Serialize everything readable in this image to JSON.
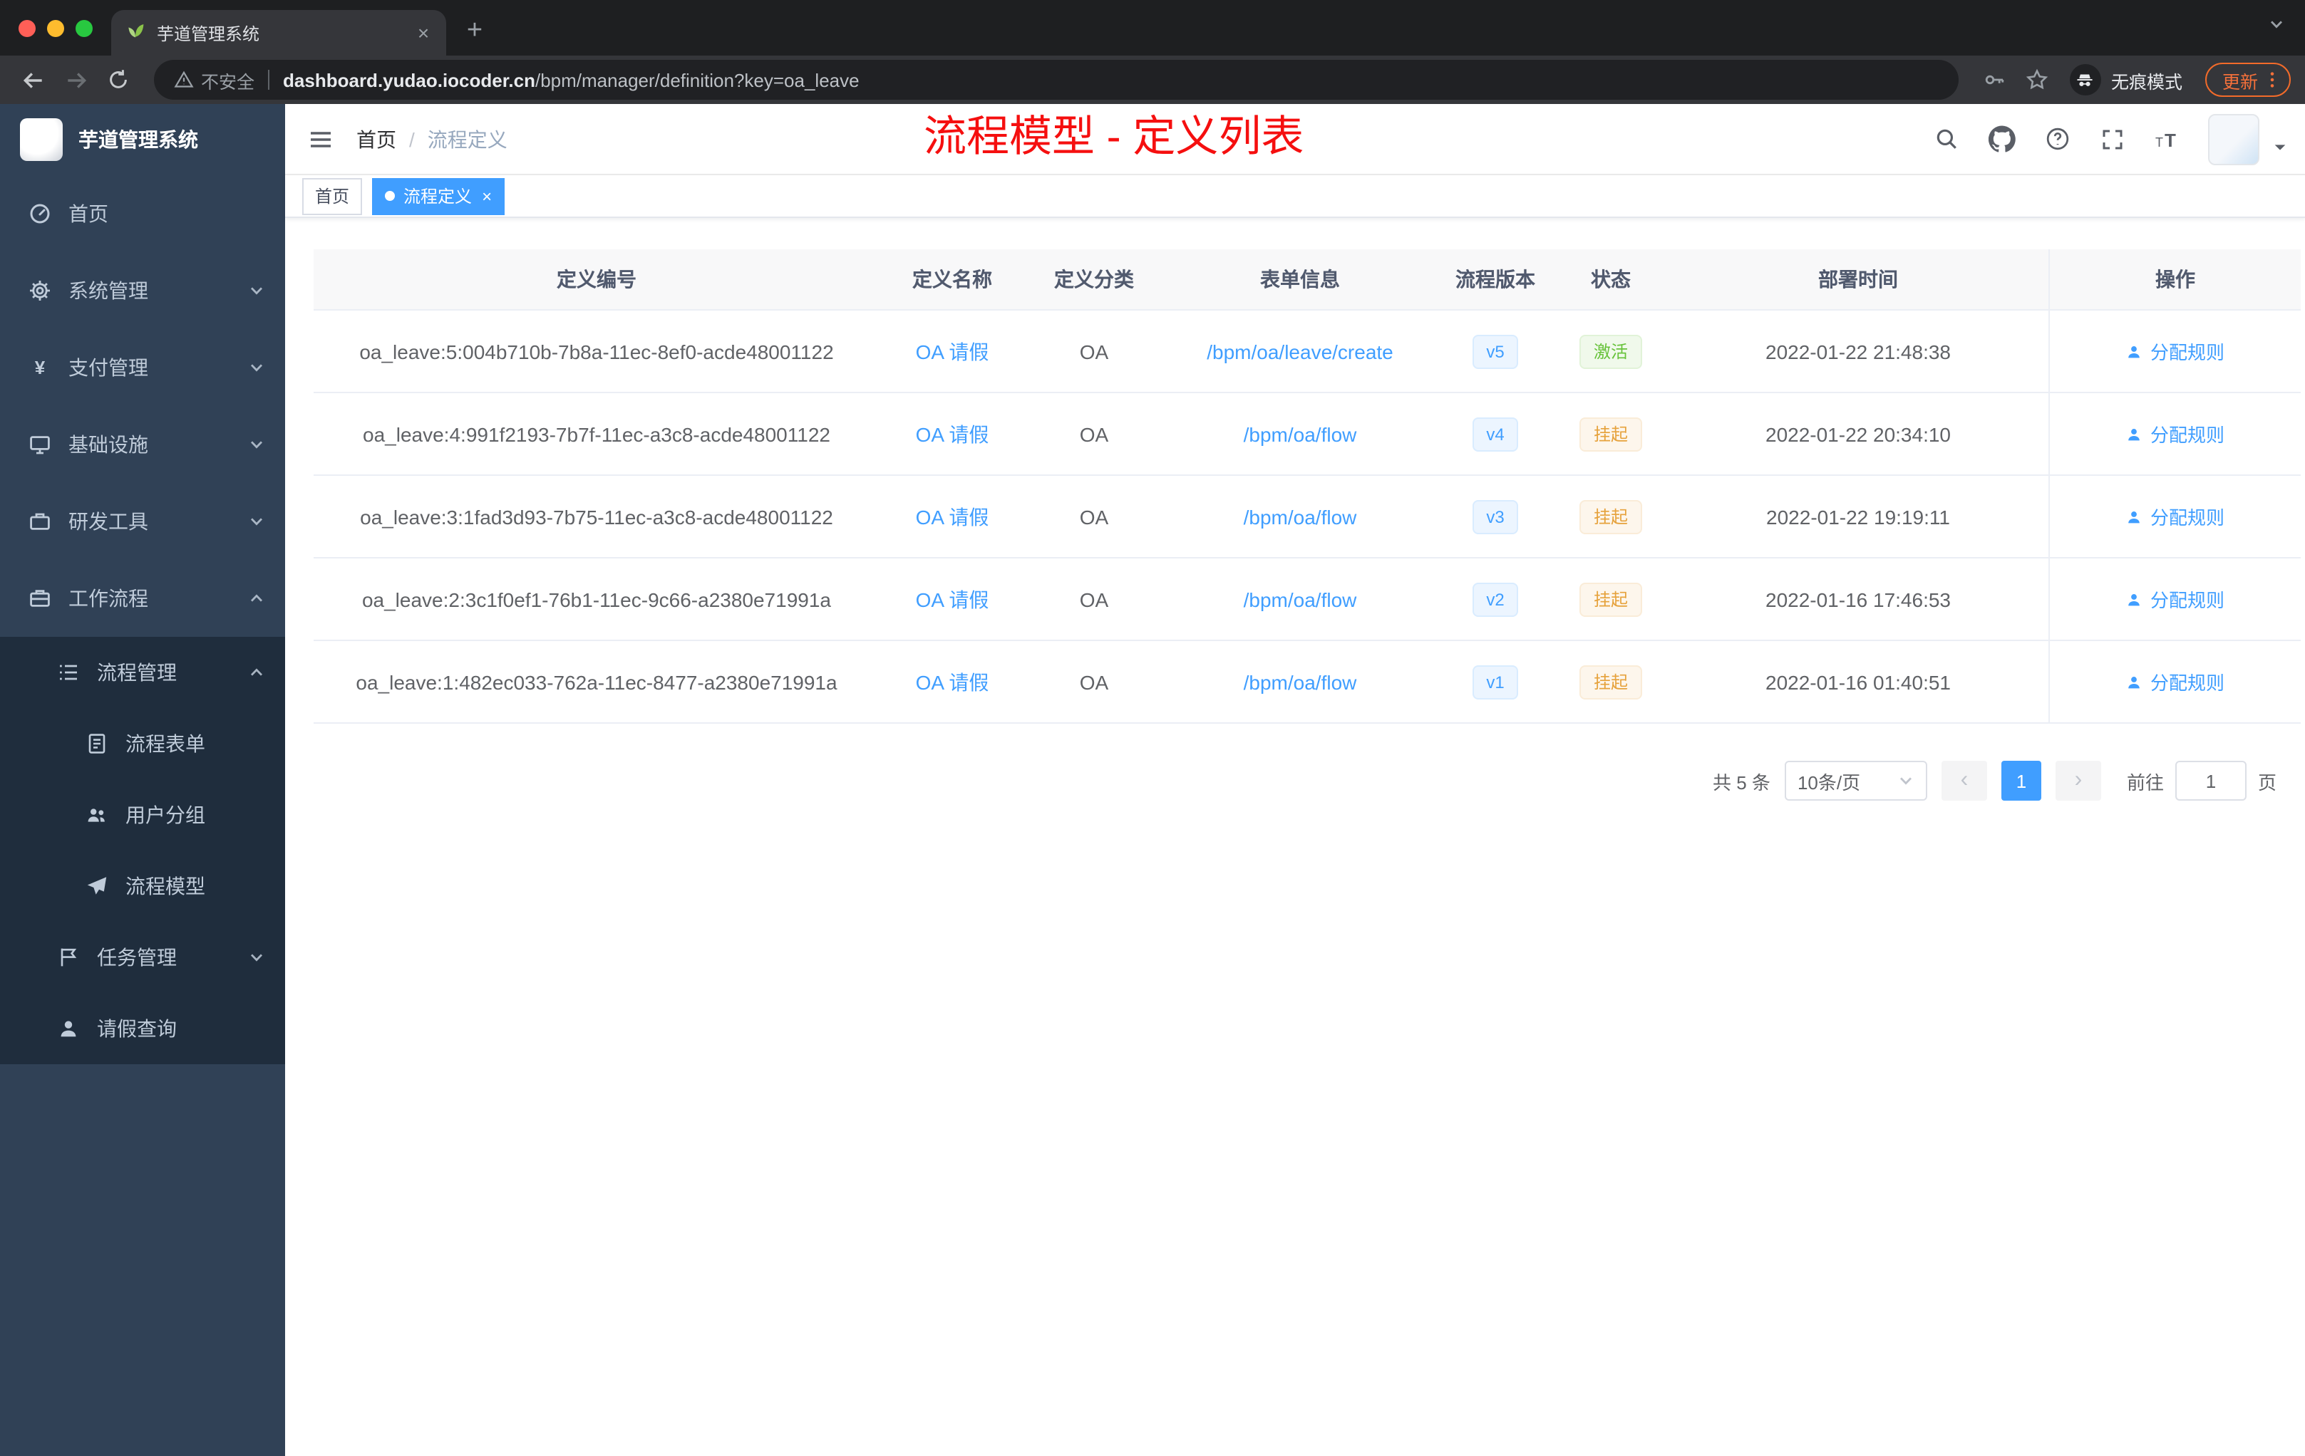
{
  "browser": {
    "tab_title": "芋道管理系统",
    "close_tab": "×",
    "new_tab": "+",
    "security_label": "不安全",
    "url_domain": "dashboard.yudao.iocoder.cn",
    "url_path": "/bpm/manager/definition?key=oa_leave",
    "incognito_label": "无痕模式",
    "update_label": "更新"
  },
  "sidebar": {
    "logo_title": "芋道管理系统",
    "items": [
      {
        "key": "home",
        "label": "首页",
        "icon": "dashboard-icon",
        "level": 1
      },
      {
        "key": "system-management",
        "label": "系统管理",
        "icon": "gear-icon",
        "level": 1,
        "expand": "down"
      },
      {
        "key": "payment-management",
        "label": "支付管理",
        "icon": "yen-icon",
        "level": 1,
        "expand": "down"
      },
      {
        "key": "infrastructure",
        "label": "基础设施",
        "icon": "monitor-icon",
        "level": 1,
        "expand": "down"
      },
      {
        "key": "dev-tools",
        "label": "研发工具",
        "icon": "toolbox-icon",
        "level": 1,
        "expand": "down"
      },
      {
        "key": "workflow",
        "label": "工作流程",
        "icon": "briefcase-icon",
        "level": 1,
        "expand": "up"
      },
      {
        "key": "process-management",
        "label": "流程管理",
        "icon": "tree-icon",
        "level": 2,
        "expand": "up"
      },
      {
        "key": "process-form",
        "label": "流程表单",
        "icon": "form-icon",
        "level": 3
      },
      {
        "key": "user-group",
        "label": "用户分组",
        "icon": "group-icon",
        "level": 3
      },
      {
        "key": "process-model",
        "label": "流程模型",
        "icon": "send-icon",
        "level": 3
      },
      {
        "key": "task-management",
        "label": "任务管理",
        "icon": "task-icon",
        "level": 2,
        "expand": "down"
      },
      {
        "key": "leave-query",
        "label": "请假查询",
        "icon": "user-icon",
        "level": 2
      }
    ]
  },
  "header": {
    "breadcrumb": {
      "home": "首页",
      "separator": "/",
      "current": "流程定义"
    },
    "annotation": "流程模型 - 定义列表"
  },
  "tags": [
    {
      "label": "首页",
      "active": false
    },
    {
      "label": "流程定义",
      "active": true,
      "close": "×"
    }
  ],
  "table": {
    "columns": [
      {
        "key": "id",
        "label": "定义编号"
      },
      {
        "key": "name",
        "label": "定义名称"
      },
      {
        "key": "category",
        "label": "定义分类"
      },
      {
        "key": "form",
        "label": "表单信息"
      },
      {
        "key": "version",
        "label": "流程版本"
      },
      {
        "key": "status",
        "label": "状态"
      },
      {
        "key": "deploy",
        "label": "部署时间"
      },
      {
        "key": "ops",
        "label": "操作"
      }
    ],
    "rows": [
      {
        "id": "oa_leave:5:004b710b-7b8a-11ec-8ef0-acde48001122",
        "name": "OA 请假",
        "category": "OA",
        "form": "/bpm/oa/leave/create",
        "version": "v5",
        "status": "激活",
        "status_type": "success",
        "deploy_time": "2022-01-22 21:48:38",
        "op_label": "分配规则"
      },
      {
        "id": "oa_leave:4:991f2193-7b7f-11ec-a3c8-acde48001122",
        "name": "OA 请假",
        "category": "OA",
        "form": "/bpm/oa/flow",
        "version": "v4",
        "status": "挂起",
        "status_type": "warning",
        "deploy_time": "2022-01-22 20:34:10",
        "op_label": "分配规则"
      },
      {
        "id": "oa_leave:3:1fad3d93-7b75-11ec-a3c8-acde48001122",
        "name": "OA 请假",
        "category": "OA",
        "form": "/bpm/oa/flow",
        "version": "v3",
        "status": "挂起",
        "status_type": "warning",
        "deploy_time": "2022-01-22 19:19:11",
        "op_label": "分配规则"
      },
      {
        "id": "oa_leave:2:3c1f0ef1-76b1-11ec-9c66-a2380e71991a",
        "name": "OA 请假",
        "category": "OA",
        "form": "/bpm/oa/flow",
        "version": "v2",
        "status": "挂起",
        "status_type": "warning",
        "deploy_time": "2022-01-16 17:46:53",
        "op_label": "分配规则"
      },
      {
        "id": "oa_leave:1:482ec033-762a-11ec-8477-a2380e71991a",
        "name": "OA 请假",
        "category": "OA",
        "form": "/bpm/oa/flow",
        "version": "v1",
        "status": "挂起",
        "status_type": "warning",
        "deploy_time": "2022-01-16 01:40:51",
        "op_label": "分配规则"
      }
    ]
  },
  "pagination": {
    "total_label": "共 5 条",
    "page_size_label": "10条/页",
    "prev": "‹",
    "current_page": "1",
    "next": "›",
    "goto_prefix": "前往",
    "goto_value": "1",
    "goto_suffix": "页"
  },
  "colors": {
    "accent": "#409eff",
    "success": "#67c23a",
    "warning": "#e6a23c",
    "annotation_red": "#f50f0f",
    "sidebar_bg": "#304156",
    "submenu_bg": "#1f2d3d"
  }
}
